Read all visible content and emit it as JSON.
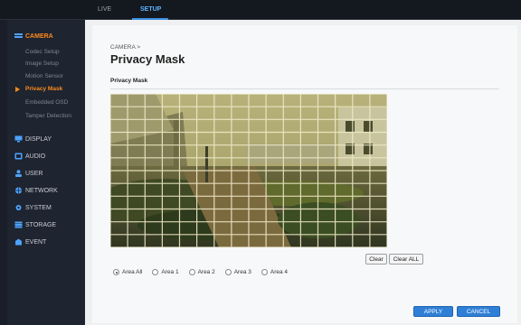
{
  "topbar": {
    "tabs": [
      {
        "label": "LIVE"
      },
      {
        "label": "SETUP"
      }
    ]
  },
  "sidebar": {
    "camera": {
      "label": "CAMERA",
      "items": [
        "Codec Setup",
        "Image Setup",
        "Motion Sensor",
        "Privacy Mask",
        "Embedded OSD",
        "Tamper Detection"
      ]
    },
    "categories": [
      {
        "label": "DISPLAY",
        "icon": "display-icon"
      },
      {
        "label": "AUDIO",
        "icon": "audio-icon"
      },
      {
        "label": "USER",
        "icon": "user-icon"
      },
      {
        "label": "NETWORK",
        "icon": "network-icon"
      },
      {
        "label": "SYSTEM",
        "icon": "system-icon"
      },
      {
        "label": "STORAGE",
        "icon": "storage-icon"
      },
      {
        "label": "EVENT",
        "icon": "event-icon"
      }
    ]
  },
  "main": {
    "breadcrumb": "CAMERA >",
    "title": "Privacy Mask",
    "section_title": "Privacy Mask",
    "clear_label": "Clear",
    "clear_all_label": "Clear ALL",
    "areas": [
      "Area All",
      "Area 1",
      "Area 2",
      "Area 3",
      "Area 4"
    ],
    "selected_area": "Area All",
    "apply_label": "APPLY",
    "cancel_label": "CANCEL"
  },
  "colors": {
    "accent": "#ff8a1c",
    "primary_button": "#2f7fd6",
    "sidebar_bg": "#1e2430",
    "topbar_bg": "#14181f"
  }
}
